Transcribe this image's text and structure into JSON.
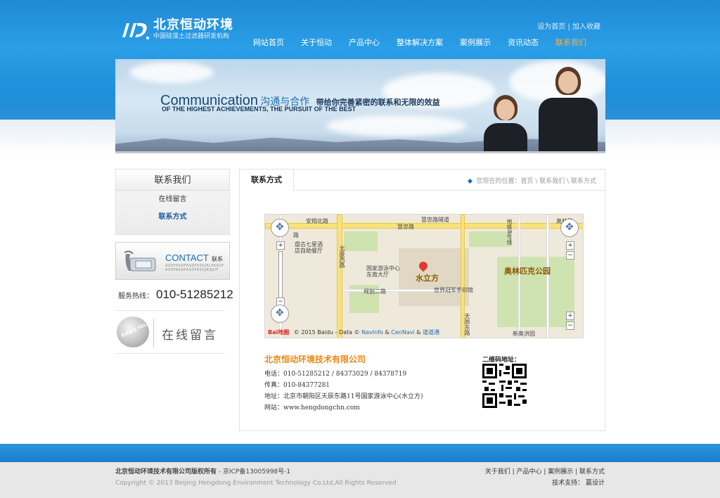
{
  "header": {
    "logo_title": "北京恒动环境",
    "logo_sub": "中国硅藻土过滤器研发机构",
    "toplinks": {
      "home": "设为首页",
      "sep": "|",
      "fav": "加入收藏"
    },
    "nav": [
      {
        "label": "网站首页"
      },
      {
        "label": "关于恒动"
      },
      {
        "label": "产品中心"
      },
      {
        "label": "整体解决方案"
      },
      {
        "label": "案例展示"
      },
      {
        "label": "资讯动态"
      },
      {
        "label": "联系我们",
        "active": true
      }
    ]
  },
  "banner": {
    "en": "Communication",
    "cn1": "沟通与合作",
    "cn2": "带给你完善紧密的联系和无限的效益",
    "sub": "OF THE HIGHEST ACHIEVEMENTS, THE PURSUIT OF THE BEST"
  },
  "sidebar": {
    "title": "联系我们",
    "links": [
      {
        "label": "在线留言"
      },
      {
        "label": "联系方式",
        "active": true
      }
    ],
    "contact_en": "CONTACT",
    "contact_cn": "联系",
    "contact_small": "ASDFASDFASDFASDJKLFASDF ASDFASDFASDFASDJASJDF",
    "hotline_label": "服务热线：",
    "hotline_number": "010-51285212",
    "message_bubble": "在线留言 HELLO!",
    "message_label": "在线留言"
  },
  "main": {
    "title": "联系方式",
    "breadcrumb": "您现在的位置：首页 \\ 联系我们 \\ 联系方式",
    "map": {
      "labels": {
        "anxiang": "安翔北路",
        "huizhong": "慧忠路",
        "huizhong_tunnel": "慧忠路隧道",
        "lu": "路",
        "restaurant": "盘古七星酒\n店自助餐厅",
        "beichen_west": "北辰西路",
        "swim_center": "国家游泳中心\n东南大厅",
        "guihua": "规划二路",
        "water_cube": "水立方",
        "world_trade": "世界冠军手印馆",
        "olympic": "奥林匹克公园",
        "tianchen": "天辰东路",
        "xindian": "新奥洪园",
        "subway": "地铁8号线",
        "qiao": "奥林路"
      },
      "copyright": "© 2015 Baidu - Data ©",
      "navinfo": "NavInfo",
      "amp1": "&",
      "cennavi": "CenNavi",
      "amp2": "&",
      "daodao": "道道通",
      "logo": "Bai地图"
    },
    "company": "北京恒动环境技术有限公司",
    "phone": "电话：010-51285212 / 84373029 / 84378719",
    "fax": "传真：010-84377281",
    "address": "地址：北京市朝阳区天辰东路11号国家游泳中心(水立方)",
    "website": "网站：www.hengdongchn.com",
    "qr_label": "二维码地址："
  },
  "footer": {
    "line1_company": "北京恒动环境技术有限公司版权所有",
    "line1_icp": " - 京ICP备13005998号-1",
    "line2": "Copyright © 2013 Beijing Hengdong Environment Technology Co.Ltd,All Rights Reserved",
    "links": "关于我们 | 产品中心 | 案例展示 | 联系方式",
    "support": "技术支持：  赢设计"
  },
  "colors": {
    "brand_blue": "#1f8ad6",
    "accent_orange": "#e88a18",
    "active_nav": "#f7b045"
  }
}
